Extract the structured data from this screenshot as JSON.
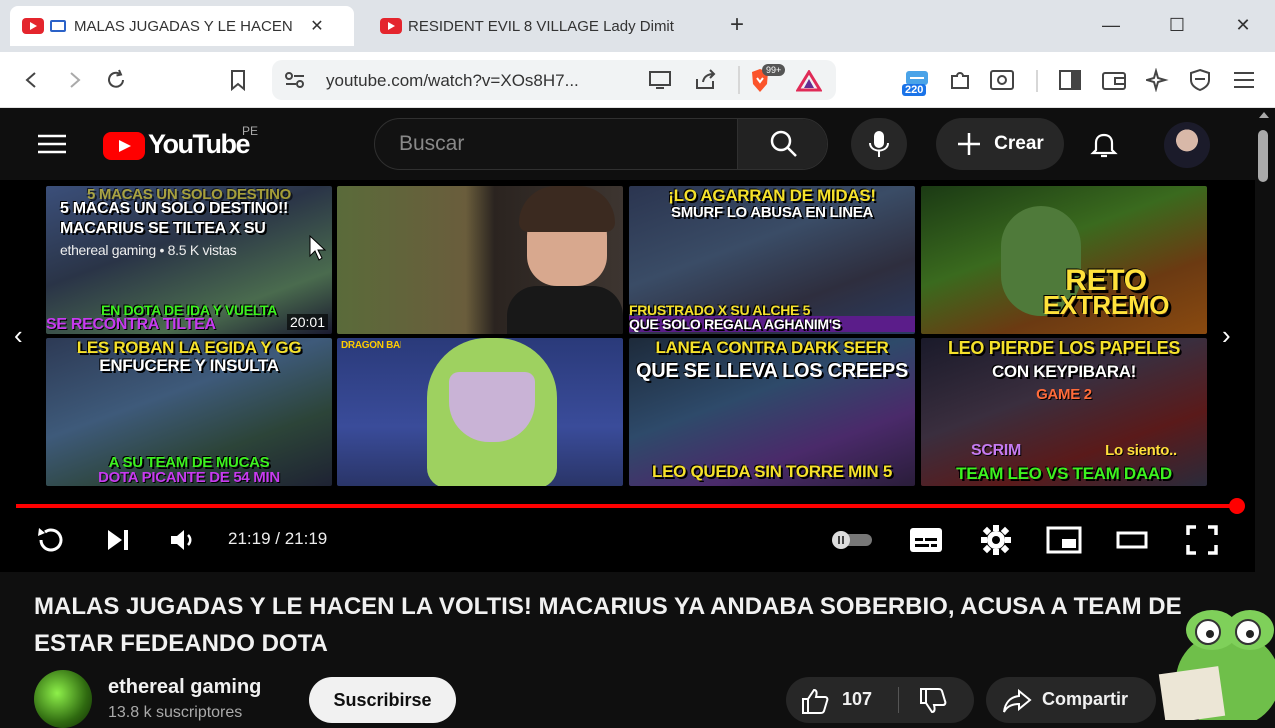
{
  "browser": {
    "tabs": [
      {
        "title": "MALAS JUGADAS Y LE HACEN",
        "active": true
      },
      {
        "title": "RESIDENT EVIL 8 VILLAGE Lady Dimit",
        "active": false
      }
    ],
    "new_tab_label": "+",
    "url": "youtube.com/watch?v=XOs8H7...",
    "brave_badge": "99+",
    "extension_badge": "220"
  },
  "youtube": {
    "logo_text": "YouTube",
    "region": "PE",
    "search_placeholder": "Buscar",
    "create_label": "Crear"
  },
  "player": {
    "end_screen": [
      {
        "top": "5 MACAS UN SOLO DESTINO!!",
        "sub": "MACARIUS SE TILTEA X SU",
        "meta": "ethereal gaming • 8.5 K vistas",
        "bottom1": "EN DOTA DE IDA Y VUELTA",
        "bottom2": "SE RECONTRA TILTEA",
        "duration": "20:01"
      },
      {
        "top": "",
        "sub": "",
        "meta": "",
        "bottom1": "",
        "bottom2": "",
        "duration": ""
      },
      {
        "top": "¡LO AGARRAN DE MIDAS!",
        "sub": "SMURF LO ABUSA EN LINEA",
        "meta": "",
        "bottom1": "FRUSTRADO X SU ALCHE 5",
        "bottom2": "QUE SOLO REGALA AGHANIM'S",
        "duration": ""
      },
      {
        "top": "RETO",
        "sub": "EXTREMO",
        "meta": "",
        "bottom1": "",
        "bottom2": "",
        "duration": ""
      },
      {
        "top": "LES ROBAN LA EGIDA Y GG",
        "sub": "ENFUCERE Y INSULTA",
        "meta": "",
        "bottom1": "A SU TEAM DE MUCAS",
        "bottom2": "DOTA PICANTE DE 54 MIN",
        "duration": ""
      },
      {
        "top": "DRAGON BALL Z",
        "sub": "",
        "meta": "",
        "bottom1": "",
        "bottom2": "",
        "duration": ""
      },
      {
        "top": "LANEA CONTRA DARK SEER",
        "sub": "QUE SE LLEVA LOS CREEPS",
        "meta": "",
        "bottom1": "LEO QUEDA SIN TORRE MIN 5",
        "bottom2": "",
        "duration": ""
      },
      {
        "top": "LEO PIERDE LOS PAPELES",
        "sub": "CON KEYPIBARA!",
        "meta": "GAME 2",
        "bottom1": "SCRIM",
        "bottom2": "TEAM LEO VS TEAM DAAD",
        "duration": "Lo siento.."
      }
    ],
    "time": "21:19 / 21:19",
    "progress": 1.0
  },
  "video": {
    "title": "MALAS JUGADAS Y LE HACEN LA VOLTIS! MACARIUS YA ANDABA SOBERBIO, ACUSA A TEAM DE ESTAR FEDEANDO DOTA",
    "channel": "ethereal gaming",
    "subscribers": "13.8 k suscriptores",
    "subscribe_label": "Suscribirse",
    "likes": "107",
    "share_label": "Compartir"
  },
  "colors": {
    "brand_red": "#ff0000",
    "bg": "#0f0f0f"
  }
}
